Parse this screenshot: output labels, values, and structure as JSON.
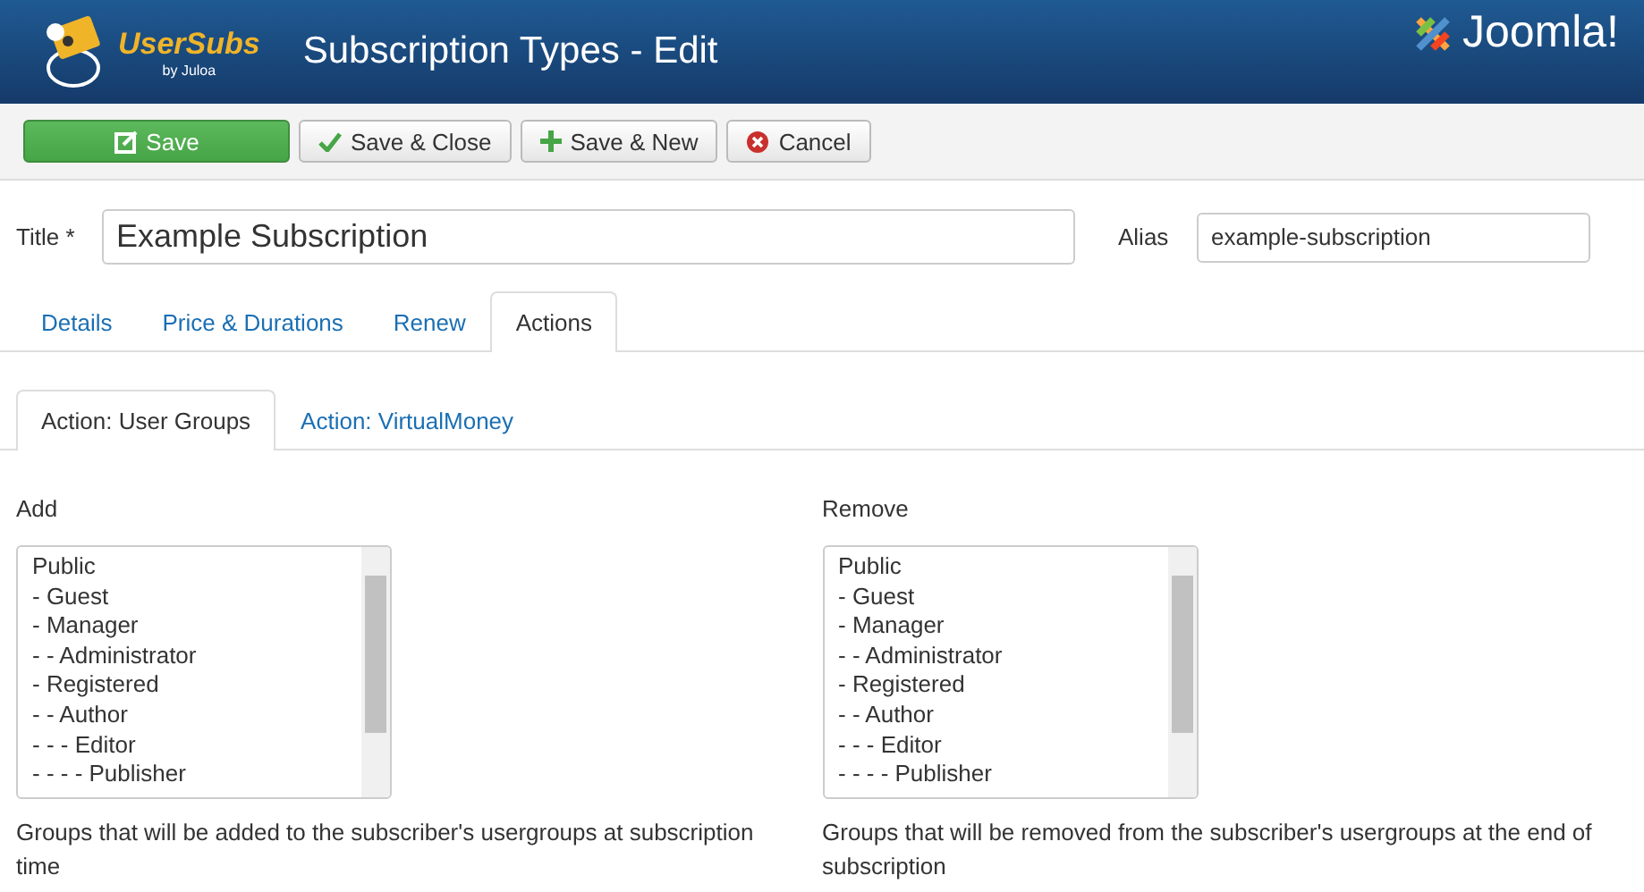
{
  "header": {
    "brand": "UserSubs",
    "brand_sub": "by Juloa",
    "title": "Subscription Types - Edit",
    "cms_logo": "Joomla!"
  },
  "toolbar": [
    {
      "label": "Save",
      "kind": "primary"
    },
    {
      "label": "Save & Close",
      "kind": "check"
    },
    {
      "label": "Save & New",
      "kind": "plus"
    },
    {
      "label": "Cancel",
      "kind": "cancel"
    }
  ],
  "title_field": {
    "label": "Title *",
    "value": "Example Subscription"
  },
  "alias_field": {
    "label": "Alias",
    "value": "example-subscription"
  },
  "tabs": [
    {
      "label": "Details",
      "selected": false
    },
    {
      "label": "Price & Durations",
      "selected": false
    },
    {
      "label": "Renew",
      "selected": false
    },
    {
      "label": "Actions",
      "selected": true
    }
  ],
  "subtabs": [
    {
      "label": "Action: User Groups",
      "selected": true
    },
    {
      "label": "Action: VirtualMoney",
      "selected": false
    }
  ],
  "groups": [
    {
      "label": "Add",
      "items": [
        "Public",
        "- Guest",
        "- Manager",
        "- - Administrator",
        "- Registered",
        "- - Author",
        "- - - Editor",
        "- - - - Publisher"
      ],
      "help": "Groups that will be added to the subscriber's usergroups at subscription time"
    },
    {
      "label": "Remove",
      "items": [
        "Public",
        "- Guest",
        "- Manager",
        "- - Administrator",
        "- Registered",
        "- - Author",
        "- - - Editor",
        "- - - - Publisher"
      ],
      "help": "Groups that will be removed from the subscriber's usergroups at the end of subscription"
    }
  ]
}
